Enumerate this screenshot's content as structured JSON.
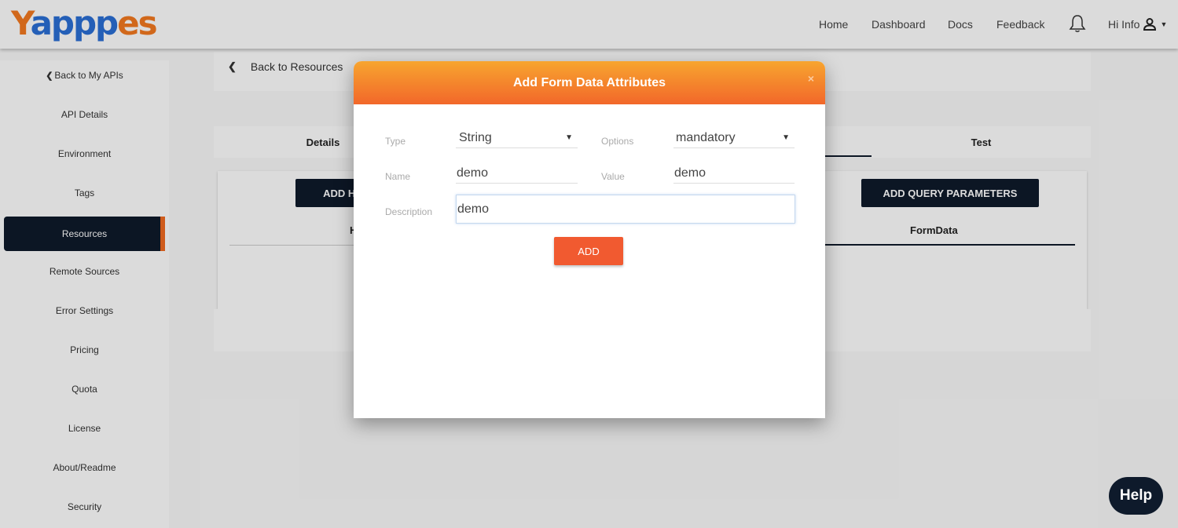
{
  "header": {
    "logo_text": {
      "y": "Y",
      "middle": "appp",
      "es": "es"
    },
    "nav": [
      "Home",
      "Dashboard",
      "Docs",
      "Feedback"
    ],
    "user_label": "Hi Info"
  },
  "sidebar": {
    "back_label": "Back to My APIs",
    "items": [
      {
        "label": "API Details"
      },
      {
        "label": "Environment"
      },
      {
        "label": "Tags"
      },
      {
        "label": "Resources"
      },
      {
        "label": "Remote Sources"
      },
      {
        "label": "Error Settings"
      },
      {
        "label": "Pricing"
      },
      {
        "label": "Quota"
      },
      {
        "label": "License"
      },
      {
        "label": "About/Readme"
      },
      {
        "label": "Security"
      }
    ],
    "active_item": "Resources"
  },
  "main": {
    "back_label": "Back to Resources",
    "tabs": {
      "details": "Details",
      "test": "Test"
    },
    "add_headers_label": "ADD HE",
    "add_query_label": "ADD QUERY PARAMETERS",
    "headers_col": "H",
    "formdata_col": "FormData"
  },
  "modal": {
    "title": "Add Form Data Attributes",
    "close": "×",
    "type_label": "Type",
    "type_value": "String",
    "options_label": "Options",
    "options_value": "mandatory",
    "name_label": "Name",
    "name_value": "demo",
    "value_label": "Value",
    "value_value": "demo",
    "description_label": "Description",
    "description_value": "demo",
    "add_label": "ADD"
  },
  "help_label": "Help",
  "colors": {
    "brand_orange": "#f26b21",
    "navy": "#0e1a2b",
    "logo_blue": "#2a6fd6",
    "add_button": "#f15a30"
  }
}
